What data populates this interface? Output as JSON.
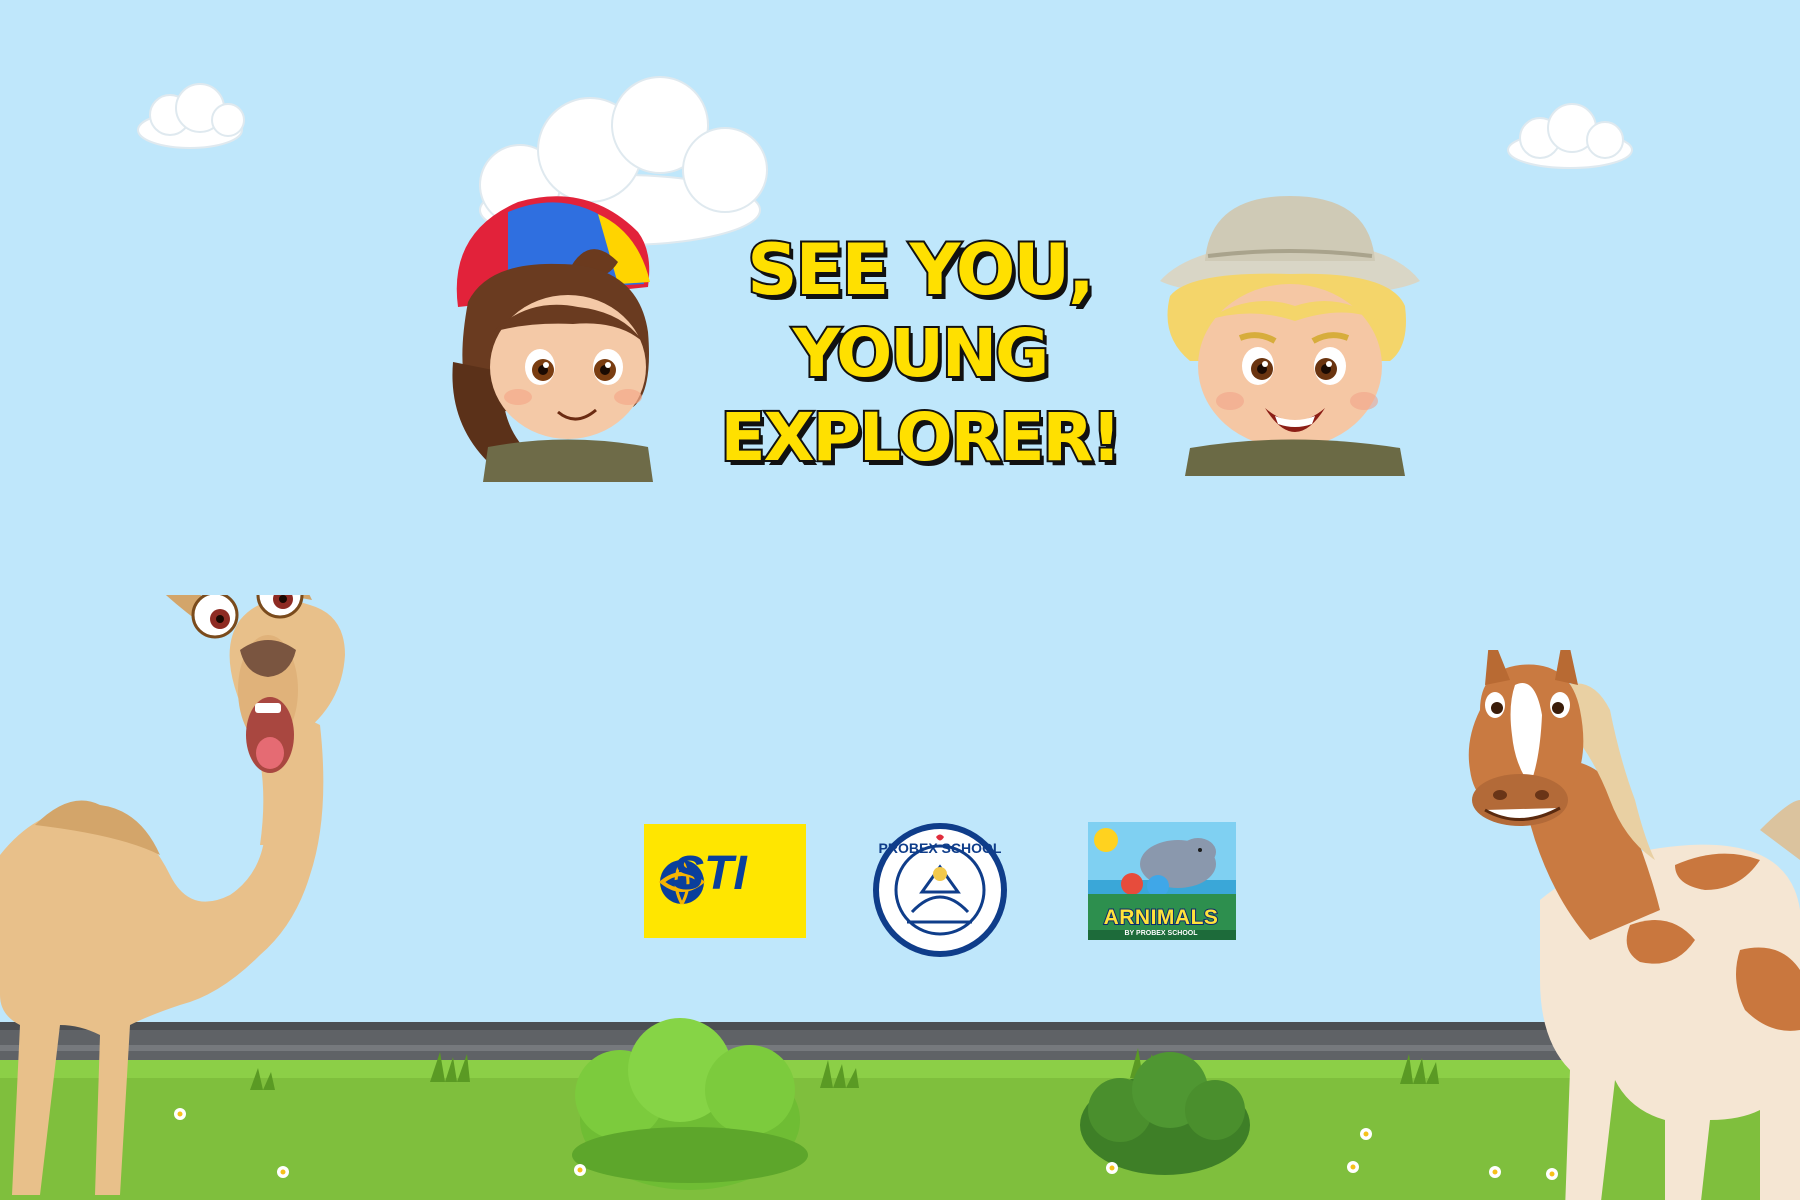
{
  "screen": {
    "sky_color": "#bfe7fb",
    "headline": {
      "line1": "SEE YOU,",
      "line2": "YOUNG EXPLORER!",
      "fill_color": "#ffe000",
      "outline_color": "#111111"
    },
    "logos": {
      "sti": {
        "text": "STI",
        "background": "#ffe600",
        "text_color": "#0a3f9c"
      },
      "probex": {
        "text": "PROBEX SCHOOL",
        "ring_color": "#0f3d8a"
      },
      "arnimals": {
        "title": "ARNIMALS",
        "subtitle": "BY PROBEX SCHOOL"
      }
    },
    "icons": {
      "girl": "girl-explorer-icon",
      "boy": "boy-explorer-icon",
      "camel": "camel-icon",
      "horse": "horse-icon",
      "clouds": "cloud-icon",
      "bushes": "bush-icon"
    },
    "ground": {
      "road_color": "#5f6266",
      "grass_color": "#7fbf3d"
    }
  }
}
